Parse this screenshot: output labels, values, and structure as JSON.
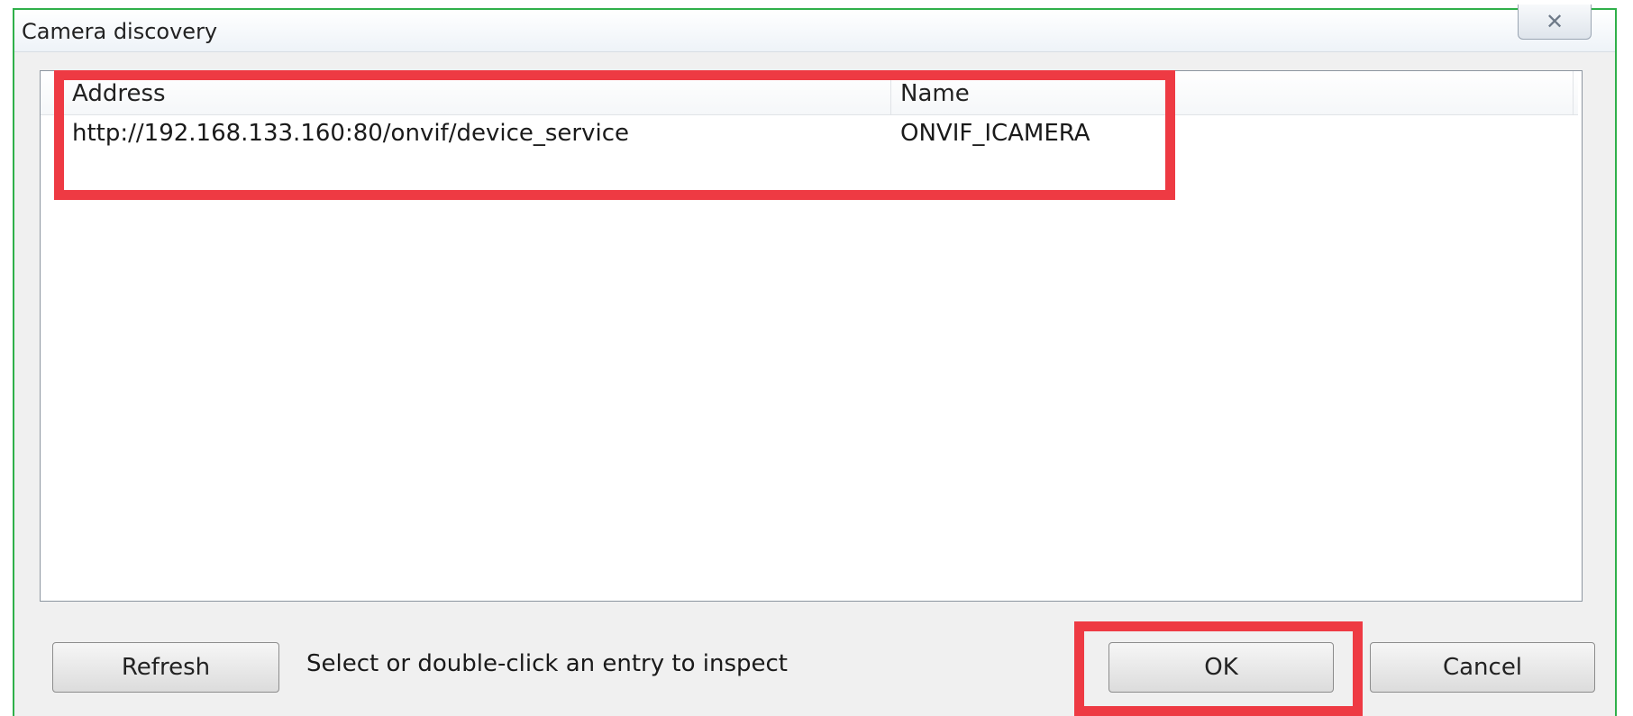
{
  "window": {
    "title": "Camera discovery",
    "close_glyph": "✕"
  },
  "list": {
    "columns": [
      "Address",
      "Name"
    ],
    "rows": [
      {
        "address": "http://192.168.133.160:80/onvif/device_service",
        "name": "ONVIF_ICAMERA"
      }
    ]
  },
  "footer": {
    "refresh_label": "Refresh",
    "status_text": "Select or double-click an entry to inspect",
    "ok_label": "OK",
    "cancel_label": "Cancel"
  },
  "colors": {
    "highlight": "#ee3a43",
    "outer_frame": "#2fb04a"
  }
}
